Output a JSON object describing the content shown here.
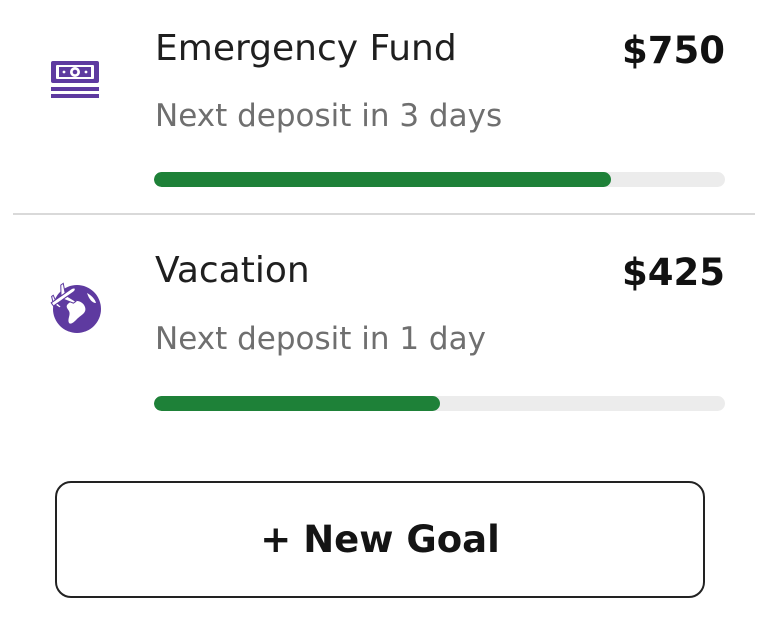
{
  "goals": [
    {
      "title": "Emergency Fund",
      "amount": "$750",
      "subtitle": "Next deposit in 3 days",
      "progress": 0.8,
      "icon": "cash-icon"
    },
    {
      "title": "Vacation",
      "amount": "$425",
      "subtitle": "Next deposit in 1 day",
      "progress": 0.5,
      "icon": "globe-plane-icon"
    }
  ],
  "new_goal_button": {
    "plus": "+",
    "label": "New Goal"
  },
  "colors": {
    "icon_purple": "#5e3aa0",
    "progress_green": "#1e8138",
    "track_gray": "#ececec"
  }
}
